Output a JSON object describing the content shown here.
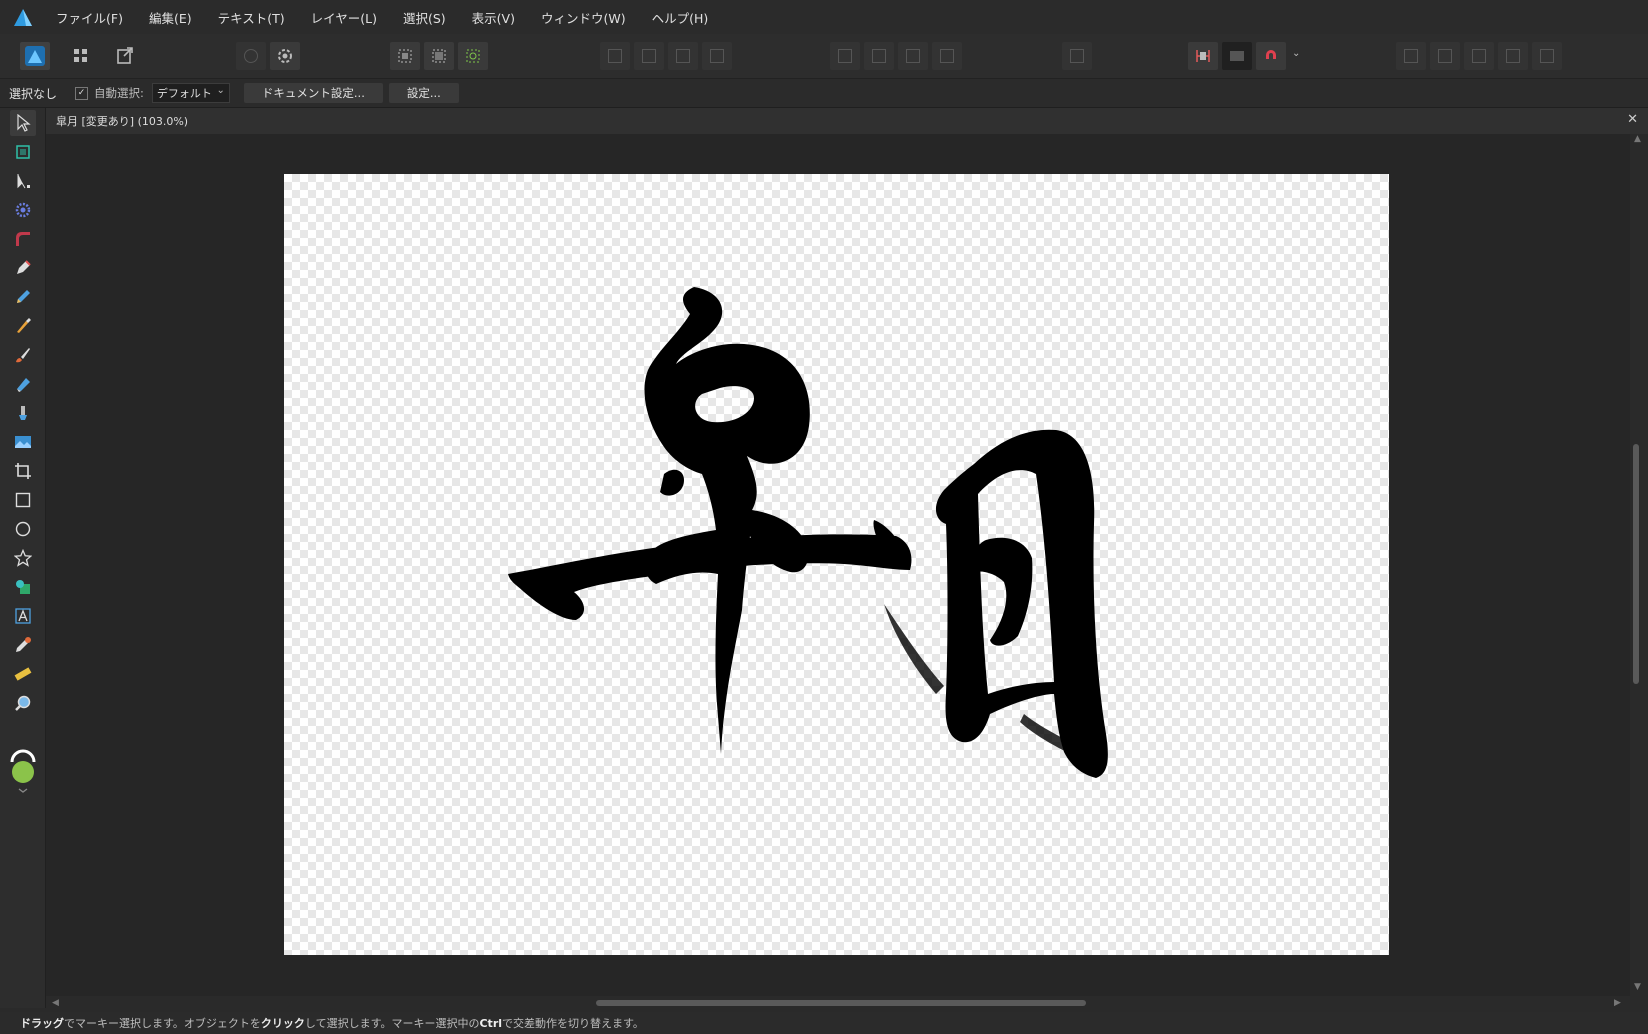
{
  "menu": {
    "items": [
      "ファイル(F)",
      "編集(E)",
      "テキスト(T)",
      "レイヤー(L)",
      "選択(S)",
      "表示(V)",
      "ウィンドウ(W)",
      "ヘルプ(H)"
    ]
  },
  "context": {
    "selection_status": "選択なし",
    "auto_select_label": "自動選択:",
    "auto_select_value": "デフォルト",
    "document_setup_button": "ドキュメント設定...",
    "preferences_button": "設定..."
  },
  "document": {
    "tab_title": "皐月 [変更あり] (103.0%)"
  },
  "status": {
    "parts": [
      {
        "text": "ドラッグ",
        "bold": true
      },
      {
        "text": "でマーキー選択します。オブジェクトを",
        "bold": false
      },
      {
        "text": "クリック",
        "bold": true
      },
      {
        "text": "して選択します。マーキー選択中の",
        "bold": false
      },
      {
        "text": "Ctrl",
        "bold": true
      },
      {
        "text": "で交差動作を切り替えます。",
        "bold": false
      }
    ]
  },
  "colors": {
    "accent": "#2f9be0",
    "primary_color": "#8bc34a",
    "ink": "#000000"
  },
  "tool_icons": [
    "move-tool-icon",
    "artboard-tool-icon",
    "node-tool-icon",
    "point-transform-icon",
    "corner-tool-icon",
    "pen-tool-icon",
    "pencil-tool-icon",
    "vector-brush-icon",
    "paint-brush-icon",
    "fill-tool-icon",
    "transparency-tool-icon",
    "place-image-icon",
    "crop-tool-icon",
    "rectangle-tool-icon",
    "ellipse-tool-icon",
    "star-tool-icon",
    "shape-tool-icon",
    "text-tool-icon",
    "color-picker-icon",
    "measure-tool-icon",
    "zoom-tool-icon"
  ]
}
